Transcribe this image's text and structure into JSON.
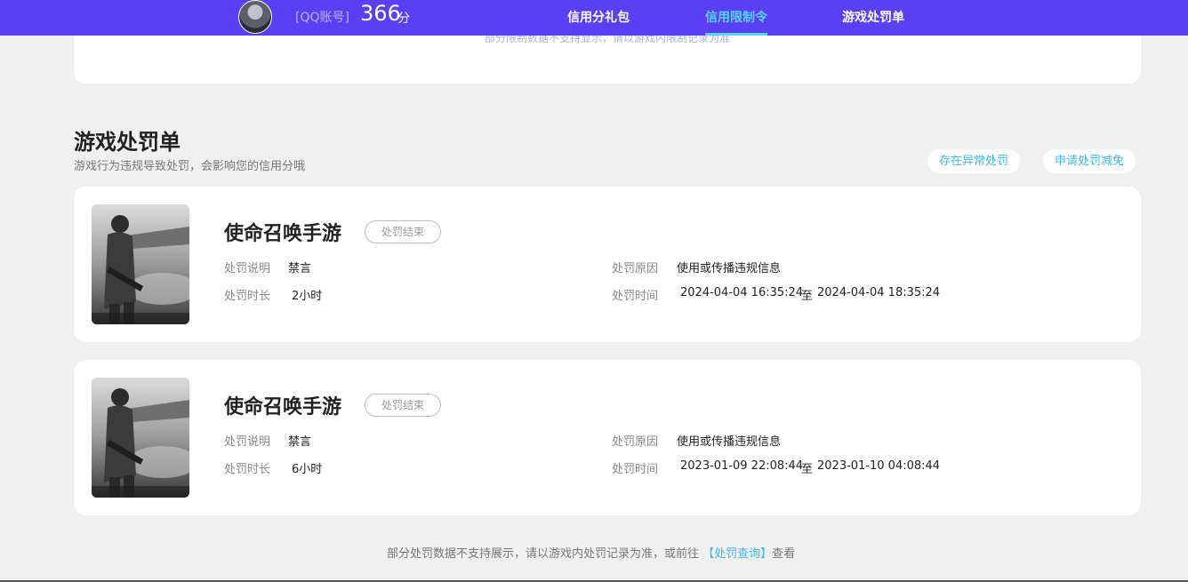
{
  "header": {
    "account_label": "[QQ账号]",
    "score": "366",
    "score_unit": "分",
    "tabs": [
      {
        "label": "信用分礼包"
      },
      {
        "label": "信用限制令"
      },
      {
        "label": "游戏处罚单"
      }
    ],
    "active_tab": "信用限制令"
  },
  "top_card": {
    "peek_text": "部分限制数据不支持显示，请以游戏内限制记录为准"
  },
  "section": {
    "title": "游戏处罚单",
    "subtitle": "游戏行为违规导致处罚，会影响您的信用分哦",
    "buttons": {
      "abnormal": "存在异常处罚",
      "reduce": "申请处罚减免"
    }
  },
  "labels": {
    "desc": "处罚说明",
    "duration": "处罚时长",
    "reason": "处罚原因",
    "time": "处罚时间",
    "time_sep": "至"
  },
  "penalties": [
    {
      "game": "使命召唤手游",
      "status": "处罚结束",
      "desc": "禁言",
      "duration": "2小时",
      "reason": "使用或传播违规信息",
      "start": "2024-04-04 16:35:24",
      "end": "2024-04-04 18:35:24"
    },
    {
      "game": "使命召唤手游",
      "status": "处罚结束",
      "desc": "禁言",
      "duration": "6小时",
      "reason": "使用或传播违规信息",
      "start": "2023-01-09 22:08:44",
      "end": "2023-01-10 04:08:44"
    }
  ],
  "footer": {
    "note_prefix": "部分处罚数据不支持展示，请以游戏内处罚记录为准，或前往",
    "link": "【处罚查询】",
    "note_suffix": "查看"
  },
  "colors": {
    "topbar": "#5a3ff5",
    "accent": "#56d6ff",
    "link": "#3fb8e6"
  }
}
